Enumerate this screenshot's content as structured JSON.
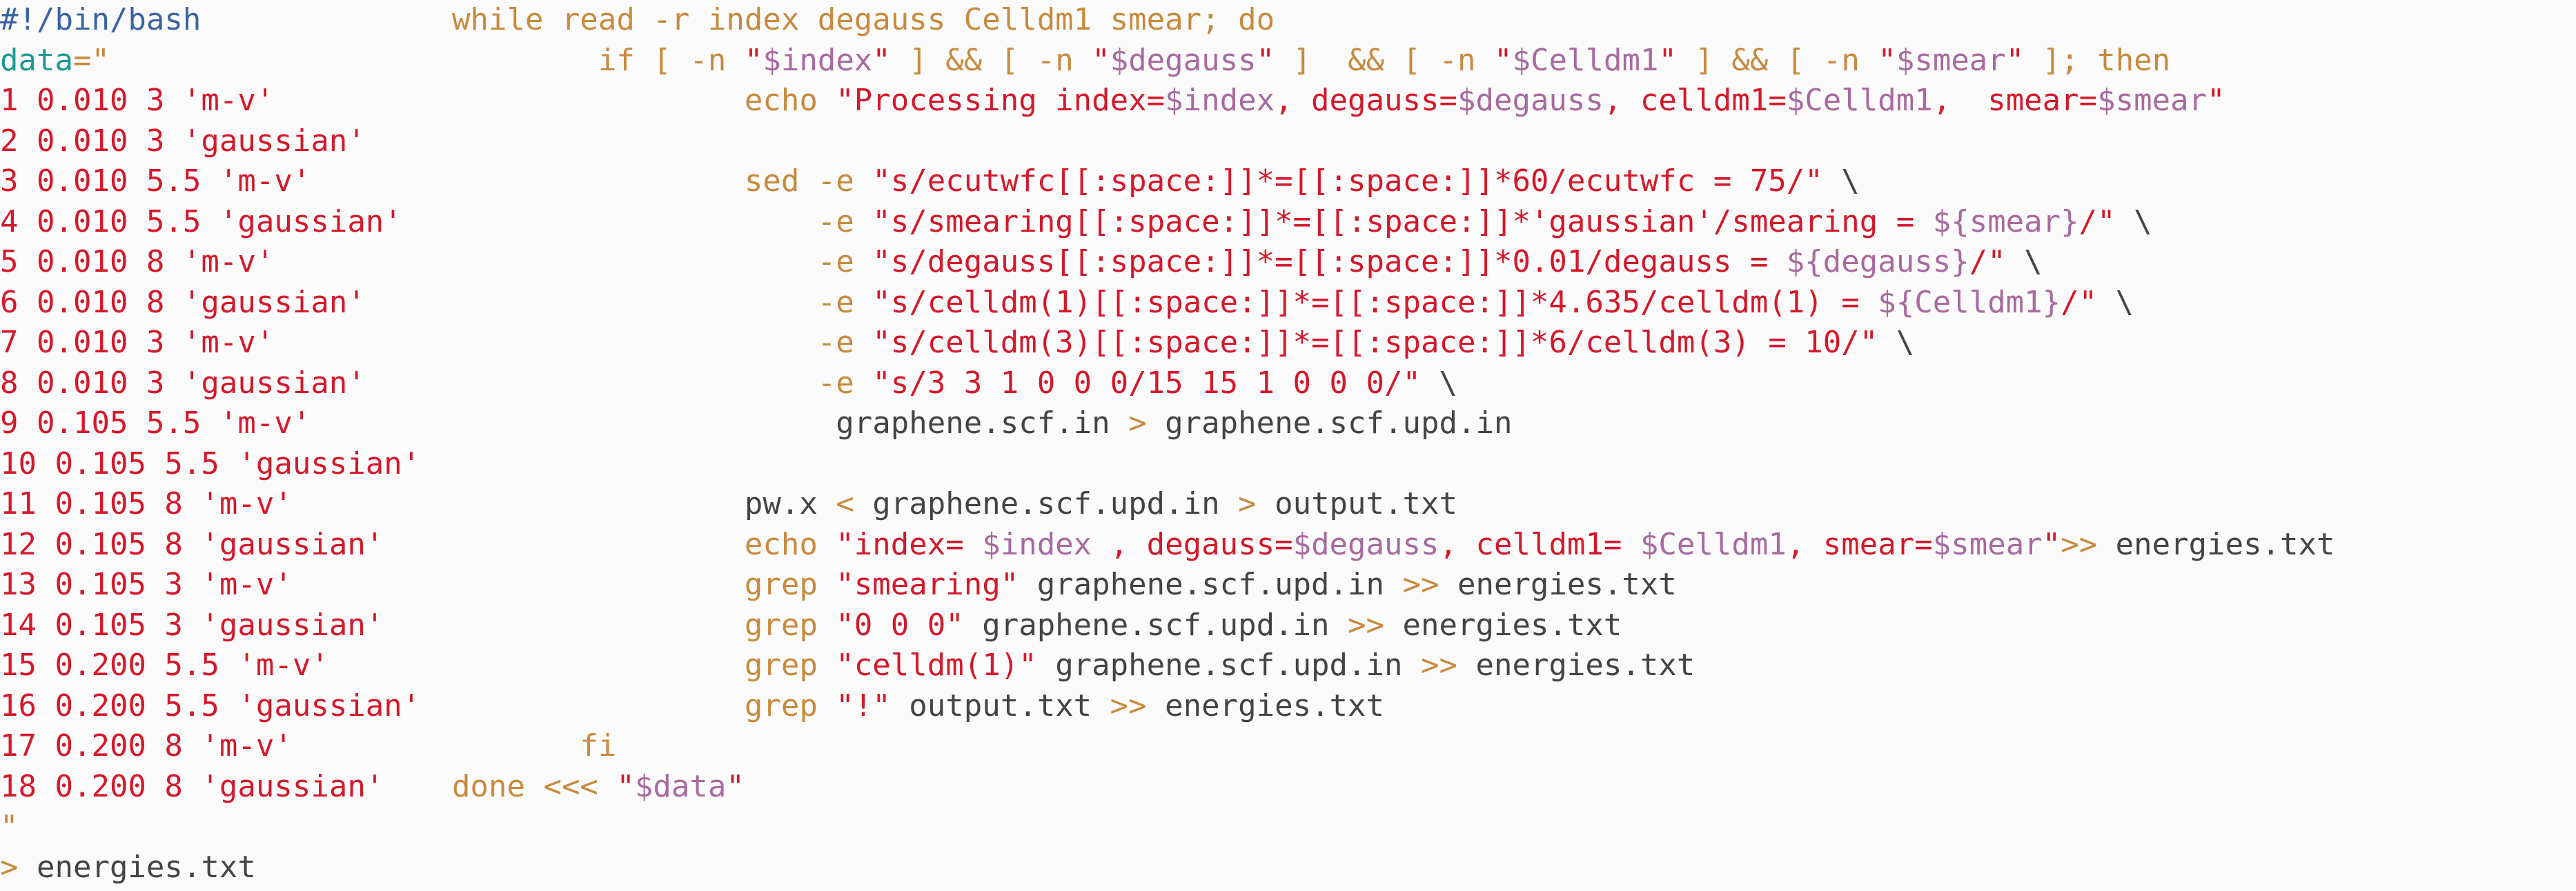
{
  "colors": {
    "background": "#fcfbfb",
    "shebang": "#3a63a3",
    "variable": "#1b9a92",
    "keyword": "#c88a3e",
    "string": "#d3192b",
    "substitution": "#a86a9f",
    "default": "#444444"
  },
  "left_lines": [
    [
      {
        "t": "#!/bin/bash",
        "c": "shebang"
      }
    ],
    [
      {
        "t": "data",
        "c": "var"
      },
      {
        "t": "=\"",
        "c": "kw"
      }
    ],
    [
      {
        "t": "1 0.010 3 'm-v'",
        "c": "str"
      }
    ],
    [
      {
        "t": "2 0.010 3 'gaussian'",
        "c": "str"
      }
    ],
    [
      {
        "t": "3 0.010 5.5 'm-v'",
        "c": "str"
      }
    ],
    [
      {
        "t": "4 0.010 5.5 'gaussian'",
        "c": "str"
      }
    ],
    [
      {
        "t": "5 0.010 8 'm-v'",
        "c": "str"
      }
    ],
    [
      {
        "t": "6 0.010 8 'gaussian'",
        "c": "str"
      }
    ],
    [
      {
        "t": "7 0.010 3 'm-v'",
        "c": "str"
      }
    ],
    [
      {
        "t": "8 0.010 3 'gaussian'",
        "c": "str"
      }
    ],
    [
      {
        "t": "9 0.105 5.5 'm-v'",
        "c": "str"
      }
    ],
    [
      {
        "t": "10 0.105 5.5 'gaussian'",
        "c": "str"
      }
    ],
    [
      {
        "t": "11 0.105 8 'm-v'",
        "c": "str"
      }
    ],
    [
      {
        "t": "12 0.105 8 'gaussian'",
        "c": "str"
      }
    ],
    [
      {
        "t": "13 0.105 3 'm-v'",
        "c": "str"
      }
    ],
    [
      {
        "t": "14 0.105 3 'gaussian'",
        "c": "str"
      }
    ],
    [
      {
        "t": "15 0.200 5.5 'm-v'",
        "c": "str"
      }
    ],
    [
      {
        "t": "16 0.200 5.5 'gaussian'",
        "c": "str"
      }
    ],
    [
      {
        "t": "17 0.200 8 'm-v'",
        "c": "str"
      }
    ],
    [
      {
        "t": "18 0.200 8 'gaussian'",
        "c": "str"
      }
    ],
    [
      {
        "t": "\"",
        "c": "kw"
      }
    ],
    [
      {
        "t": "> ",
        "c": "kw"
      },
      {
        "t": "energies.txt",
        "c": "def"
      }
    ]
  ],
  "right_lines": [
    [
      {
        "t": "while read -r index degauss Celldm1 smear; do",
        "c": "kw"
      }
    ],
    [
      {
        "t": "        if [ -n ",
        "c": "kw"
      },
      {
        "t": "\"",
        "c": "str"
      },
      {
        "t": "$index",
        "c": "sub"
      },
      {
        "t": "\"",
        "c": "str"
      },
      {
        "t": " ] && [ -n ",
        "c": "kw"
      },
      {
        "t": "\"",
        "c": "str"
      },
      {
        "t": "$degauss",
        "c": "sub"
      },
      {
        "t": "\"",
        "c": "str"
      },
      {
        "t": " ]  && [ -n ",
        "c": "kw"
      },
      {
        "t": "\"",
        "c": "str"
      },
      {
        "t": "$Celldm1",
        "c": "sub"
      },
      {
        "t": "\"",
        "c": "str"
      },
      {
        "t": " ] && [ -n ",
        "c": "kw"
      },
      {
        "t": "\"",
        "c": "str"
      },
      {
        "t": "$smear",
        "c": "sub"
      },
      {
        "t": "\"",
        "c": "str"
      },
      {
        "t": " ]; then",
        "c": "kw"
      }
    ],
    [
      {
        "t": "                echo ",
        "c": "kw"
      },
      {
        "t": "\"Processing index=",
        "c": "str"
      },
      {
        "t": "$index",
        "c": "sub"
      },
      {
        "t": ", degauss=",
        "c": "str"
      },
      {
        "t": "$degauss",
        "c": "sub"
      },
      {
        "t": ", celldm1=",
        "c": "str"
      },
      {
        "t": "$Celldm1",
        "c": "sub"
      },
      {
        "t": ",  smear=",
        "c": "str"
      },
      {
        "t": "$smear",
        "c": "sub"
      },
      {
        "t": "\"",
        "c": "str"
      }
    ],
    [
      {
        "t": "",
        "c": "def"
      }
    ],
    [
      {
        "t": "                sed -e ",
        "c": "kw"
      },
      {
        "t": "\"s/ecutwfc[[:space:]]*=[[:space:]]*60/ecutwfc = 75/\"",
        "c": "str"
      },
      {
        "t": " \\",
        "c": "def"
      }
    ],
    [
      {
        "t": "                    -e ",
        "c": "kw"
      },
      {
        "t": "\"s/smearing[[:space:]]*=[[:space:]]*'gaussian'/smearing = ",
        "c": "str"
      },
      {
        "t": "${smear}",
        "c": "sub"
      },
      {
        "t": "/\"",
        "c": "str"
      },
      {
        "t": " \\",
        "c": "def"
      }
    ],
    [
      {
        "t": "                    -e ",
        "c": "kw"
      },
      {
        "t": "\"s/degauss[[:space:]]*=[[:space:]]*0.01/degauss = ",
        "c": "str"
      },
      {
        "t": "${degauss}",
        "c": "sub"
      },
      {
        "t": "/\"",
        "c": "str"
      },
      {
        "t": " \\",
        "c": "def"
      }
    ],
    [
      {
        "t": "                    -e ",
        "c": "kw"
      },
      {
        "t": "\"s/celldm(1)[[:space:]]*=[[:space:]]*4.635/celldm(1) = ",
        "c": "str"
      },
      {
        "t": "${Celldm1}",
        "c": "sub"
      },
      {
        "t": "/\"",
        "c": "str"
      },
      {
        "t": " \\",
        "c": "def"
      }
    ],
    [
      {
        "t": "                    -e ",
        "c": "kw"
      },
      {
        "t": "\"s/celldm(3)[[:space:]]*=[[:space:]]*6/celldm(3) = 10/\"",
        "c": "str"
      },
      {
        "t": " \\",
        "c": "def"
      }
    ],
    [
      {
        "t": "                    -e ",
        "c": "kw"
      },
      {
        "t": "\"s/3 3 1 0 0 0/15 15 1 0 0 0/\"",
        "c": "str"
      },
      {
        "t": " \\",
        "c": "def"
      }
    ],
    [
      {
        "t": "                     graphene.scf.in ",
        "c": "def"
      },
      {
        "t": ">",
        "c": "kw"
      },
      {
        "t": " graphene.scf.upd.in",
        "c": "def"
      }
    ],
    [
      {
        "t": "",
        "c": "def"
      }
    ],
    [
      {
        "t": "                pw.x ",
        "c": "def"
      },
      {
        "t": "<",
        "c": "kw"
      },
      {
        "t": " graphene.scf.upd.in ",
        "c": "def"
      },
      {
        "t": ">",
        "c": "kw"
      },
      {
        "t": " output.txt",
        "c": "def"
      }
    ],
    [
      {
        "t": "                echo ",
        "c": "kw"
      },
      {
        "t": "\"index= ",
        "c": "str"
      },
      {
        "t": "$index",
        "c": "sub"
      },
      {
        "t": " , degauss=",
        "c": "str"
      },
      {
        "t": "$degauss",
        "c": "sub"
      },
      {
        "t": ", celldm1= ",
        "c": "str"
      },
      {
        "t": "$Celldm1",
        "c": "sub"
      },
      {
        "t": ", smear=",
        "c": "str"
      },
      {
        "t": "$smear",
        "c": "sub"
      },
      {
        "t": "\"",
        "c": "str"
      },
      {
        "t": ">>",
        "c": "kw"
      },
      {
        "t": " energies.txt",
        "c": "def"
      }
    ],
    [
      {
        "t": "                grep ",
        "c": "kw"
      },
      {
        "t": "\"smearing\"",
        "c": "str"
      },
      {
        "t": " graphene.scf.upd.in ",
        "c": "def"
      },
      {
        "t": ">>",
        "c": "kw"
      },
      {
        "t": " energies.txt",
        "c": "def"
      }
    ],
    [
      {
        "t": "                grep ",
        "c": "kw"
      },
      {
        "t": "\"0 0 0\"",
        "c": "str"
      },
      {
        "t": " graphene.scf.upd.in ",
        "c": "def"
      },
      {
        "t": ">>",
        "c": "kw"
      },
      {
        "t": " energies.txt",
        "c": "def"
      }
    ],
    [
      {
        "t": "                grep ",
        "c": "kw"
      },
      {
        "t": "\"celldm(1)\"",
        "c": "str"
      },
      {
        "t": " graphene.scf.upd.in ",
        "c": "def"
      },
      {
        "t": ">>",
        "c": "kw"
      },
      {
        "t": " energies.txt",
        "c": "def"
      }
    ],
    [
      {
        "t": "                grep ",
        "c": "kw"
      },
      {
        "t": "\"!\"",
        "c": "str"
      },
      {
        "t": " output.txt ",
        "c": "def"
      },
      {
        "t": ">>",
        "c": "kw"
      },
      {
        "t": " energies.txt",
        "c": "def"
      }
    ],
    [
      {
        "t": "       fi",
        "c": "kw"
      }
    ],
    [
      {
        "t": "done <<< ",
        "c": "kw"
      },
      {
        "t": "\"",
        "c": "str"
      },
      {
        "t": "$data",
        "c": "sub"
      },
      {
        "t": "\"",
        "c": "str"
      }
    ]
  ]
}
